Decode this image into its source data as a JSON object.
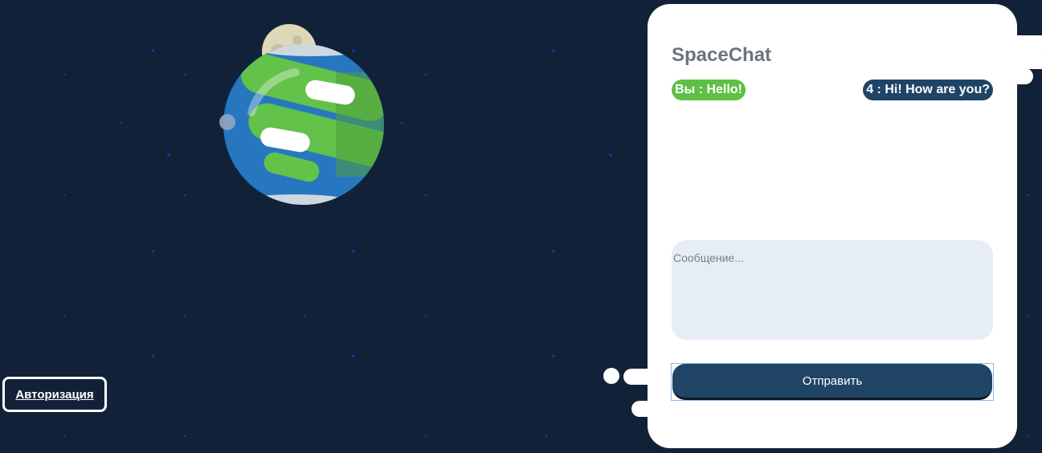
{
  "app": {
    "title": "SpaceChat"
  },
  "auth": {
    "label": "Авторизация"
  },
  "chat": {
    "messages": [
      {
        "author": "Вы",
        "text": "Hello!",
        "display": "Вы : Hello!",
        "own": true
      },
      {
        "author": "4",
        "text": "Hi! How are you?",
        "display": "4 : Hi! How are you?",
        "own": false
      }
    ],
    "input": {
      "placeholder": "Сообщение...",
      "value": ""
    },
    "send_label": "Отправить"
  },
  "colors": {
    "background": "#112238",
    "own_message": "#5ec046",
    "other_message": "#1f4466",
    "send_button": "#1f4466",
    "input_bg": "#e6edf5",
    "title_text": "#6b7480"
  },
  "icons": {
    "planet": "earth-planet-illustration"
  }
}
